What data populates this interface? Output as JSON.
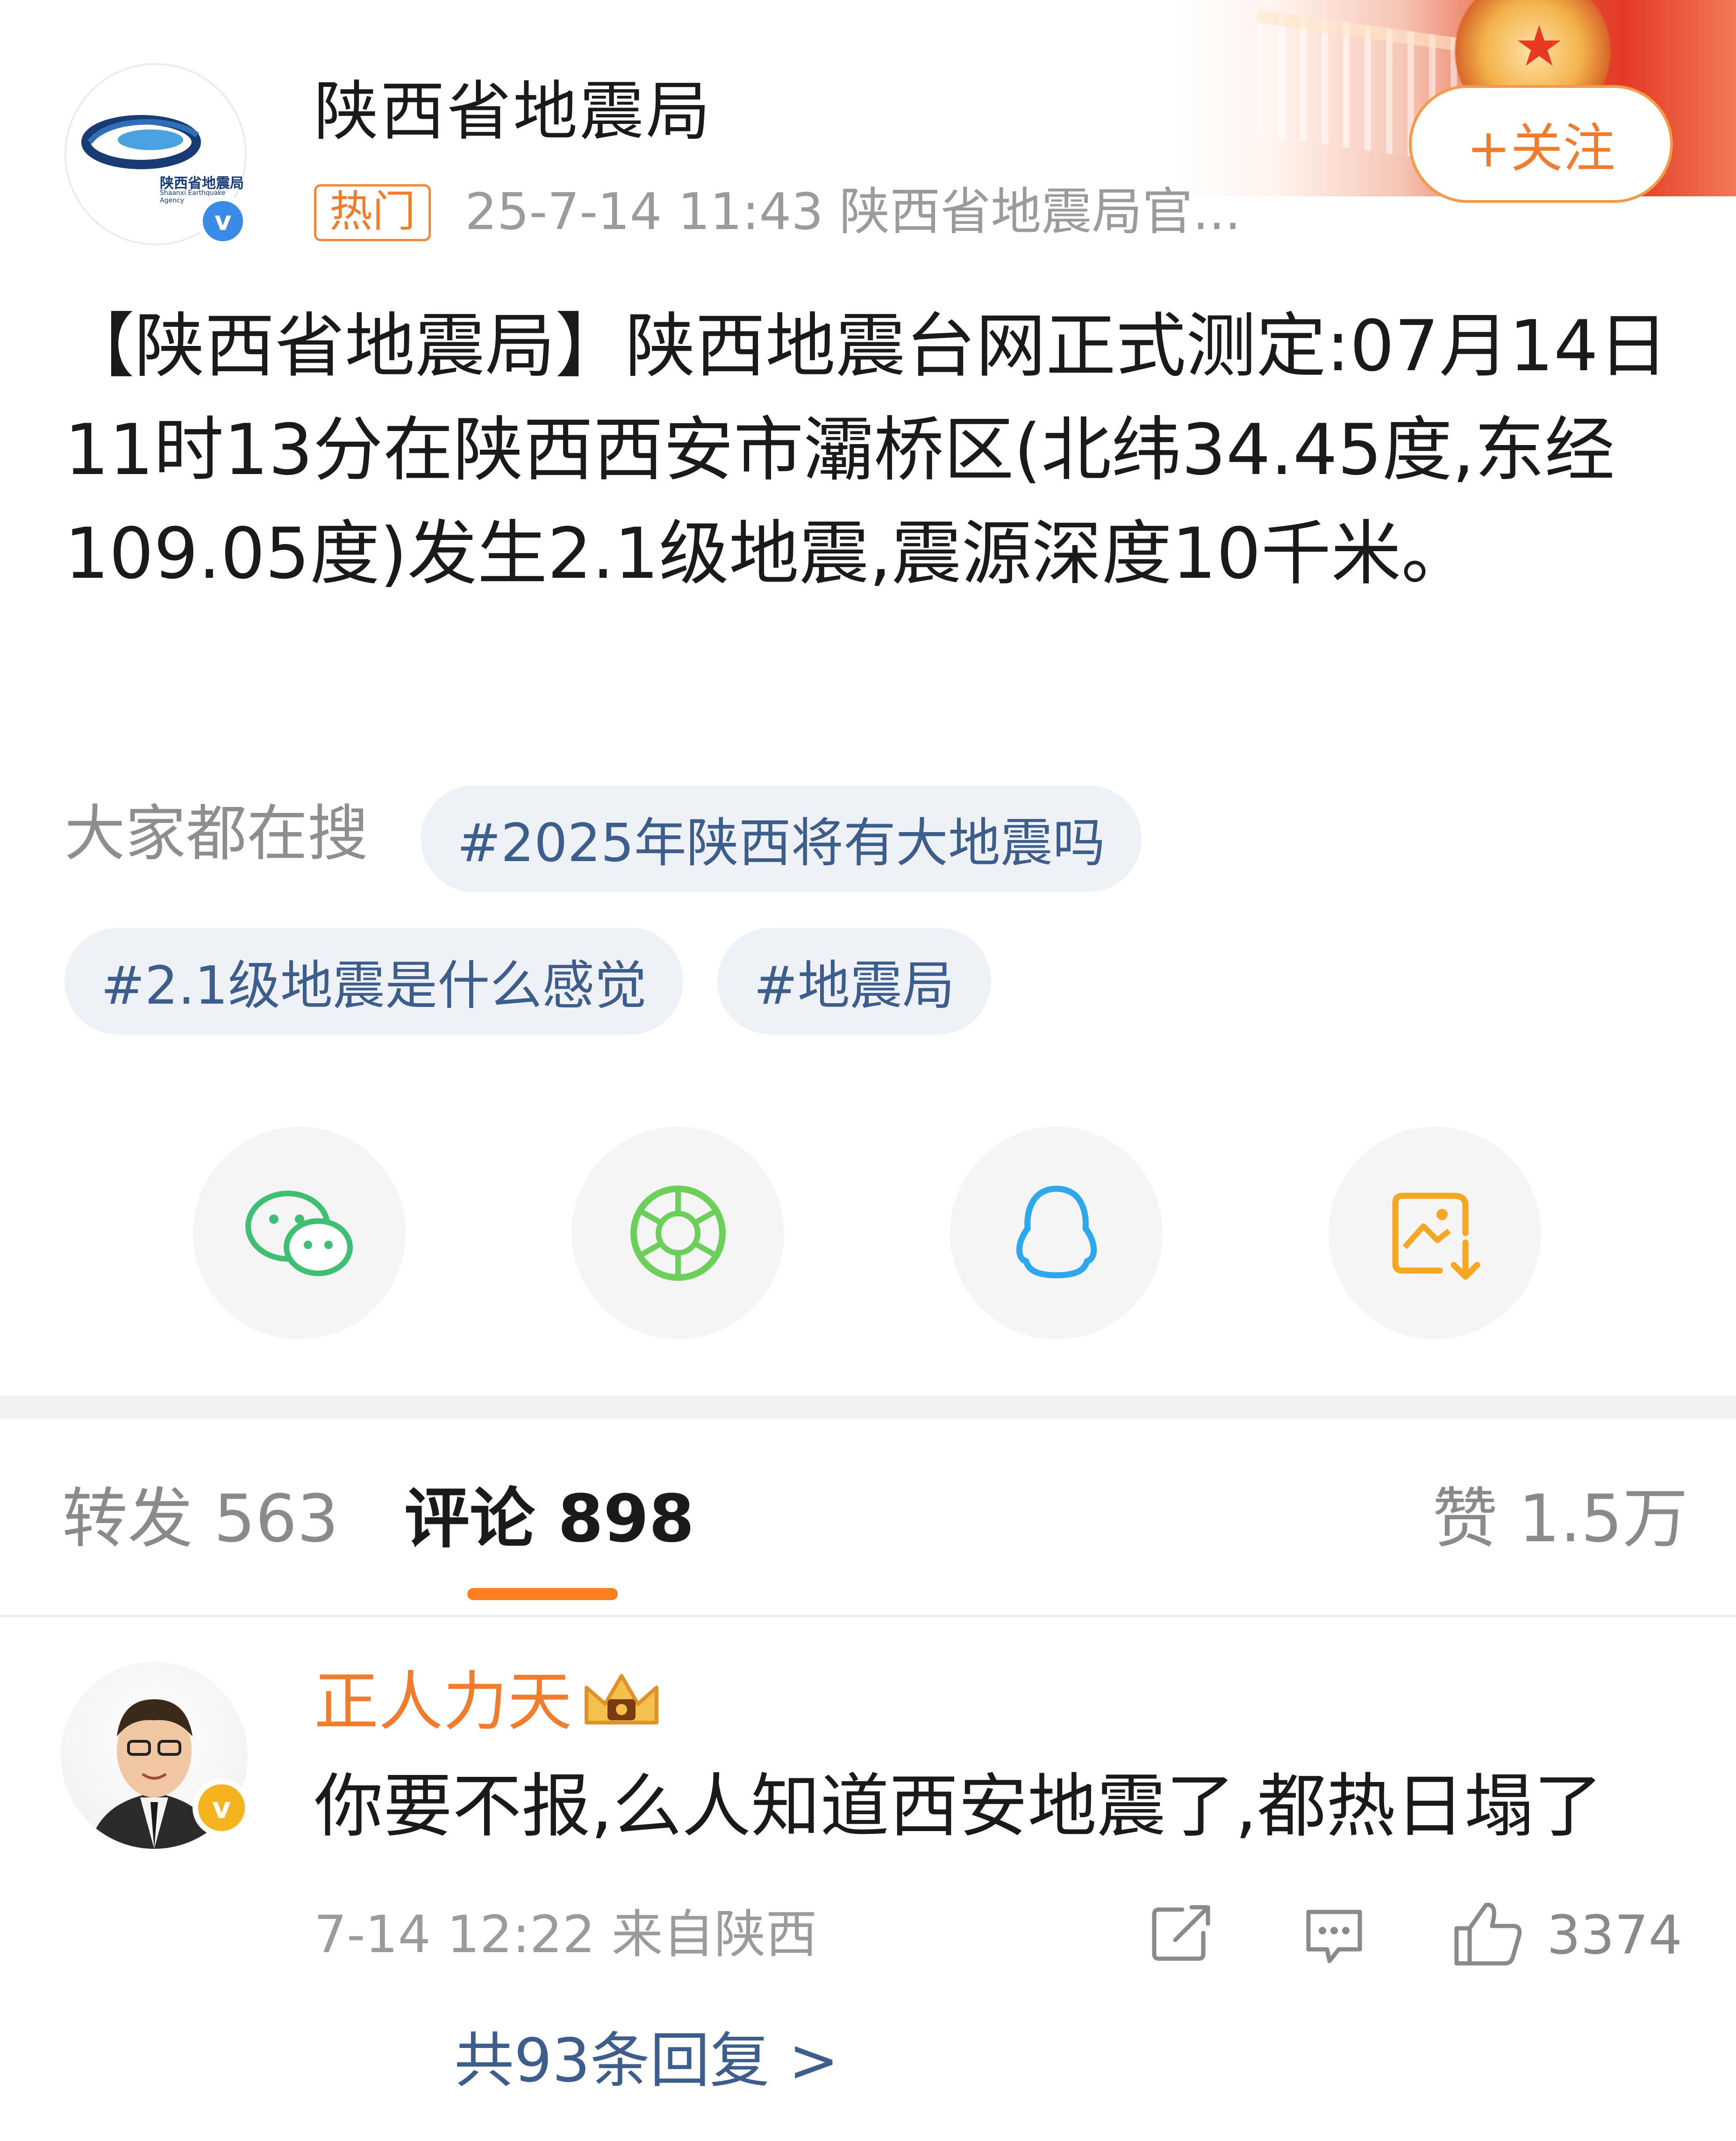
{
  "header": {
    "author_name": "陕西省地震局",
    "avatar_org_cn": "陕西省地震局",
    "avatar_org_en": "Shaanxi Earthquake Agency",
    "hot_badge": "热门",
    "meta": "25-7-14 11:43  陕西省地震局官...",
    "follow_label": "+关注",
    "verified_mark": "v"
  },
  "post": {
    "text": "【陕西省地震局】陕西地震台网正式测定:07月14日11时13分在陕西西安市灞桥区(北纬34.45度,东经109.05度)发生2.1级地震,震源深度10千米。"
  },
  "search": {
    "label": "大家都在搜",
    "tags": [
      "#2025年陕西将有大地震吗",
      "#2.1级地震是什么感觉",
      "#地震局"
    ]
  },
  "share": {
    "icons": [
      "wechat-icon",
      "moments-icon",
      "qq-icon",
      "save-image-icon"
    ],
    "colors": {
      "wechat": "#3fbf74",
      "moments": "#6ccf5a",
      "qq": "#2ea8ec",
      "save": "#f5a623"
    }
  },
  "tabs": {
    "repost": "转发 563",
    "comments": "评论 898",
    "likes": "赞 1.5万"
  },
  "comment": {
    "author": "正人力天",
    "text": "你要不报,么人知道西安地震了,都热日塌了",
    "time_location": "7-14 12:22  来自陕西",
    "like_count": "3374",
    "replies": "共93条回复 >",
    "verified_mark": "v"
  },
  "colors": {
    "accent": "#f07d2e",
    "tab_indicator": "#ff7e1d",
    "link": "#3d5d8c",
    "muted": "#9b9b9b"
  }
}
